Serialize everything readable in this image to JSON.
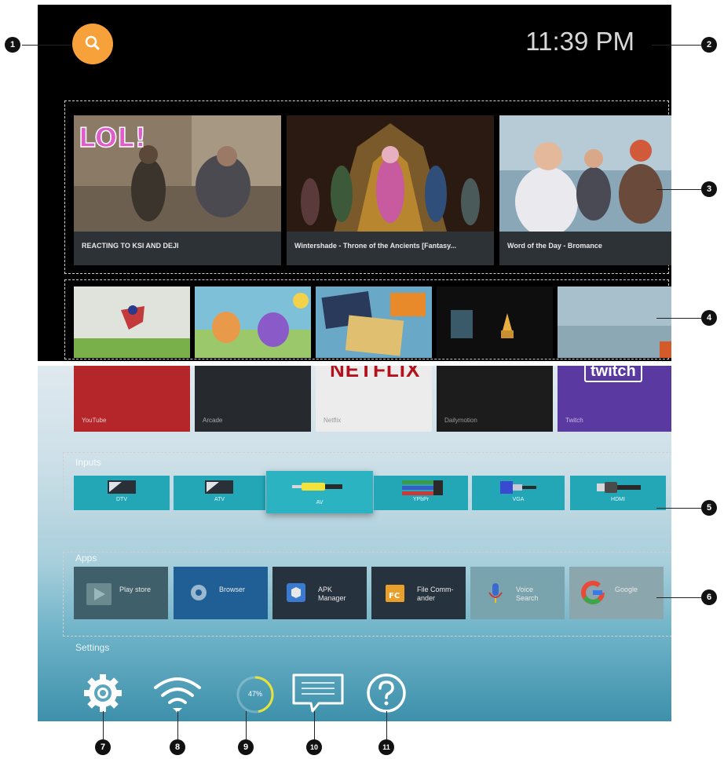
{
  "header": {
    "time": "11:39 PM"
  },
  "recommended": [
    {
      "title": "REACTING TO KSI AND DEJI",
      "overlay": "LOL!"
    },
    {
      "title": "Wintershade - Throne of the Ancients [Fantasy..."
    },
    {
      "title": "Word of the Day - Bromance"
    }
  ],
  "shelf_apps": [
    {
      "label": "YouTube",
      "banner": ""
    },
    {
      "label": "Arcade"
    },
    {
      "label": "Netflix",
      "banner": "NETFLIX"
    },
    {
      "label": "Dailymotion"
    },
    {
      "label": "Twitch",
      "banner": "twitch"
    }
  ],
  "inputs_section": {
    "label": "Inputs"
  },
  "inputs": [
    {
      "label": "DTV",
      "icon": "tv-icon"
    },
    {
      "label": "ATV",
      "icon": "tv-icon"
    },
    {
      "label": "AV",
      "icon": "rca-cable-icon"
    },
    {
      "label": "YPbPr",
      "icon": "component-cable-icon"
    },
    {
      "label": "VGA",
      "icon": "vga-cable-icon"
    },
    {
      "label": "HDMI",
      "icon": "hdmi-cable-icon"
    }
  ],
  "apps_section": {
    "label": "Apps"
  },
  "apps": [
    {
      "label": "Play store",
      "color": "#3f5f6b"
    },
    {
      "label": "Browser",
      "color": "#1f5f96"
    },
    {
      "label": "APK\nManager",
      "color": "#27323f"
    },
    {
      "label": "File Comm-\nander",
      "color": "#27323f"
    },
    {
      "label": "Voice\nSearch",
      "color": "#7aa4ad"
    },
    {
      "label": "Google",
      "color": "#8ca6ad"
    }
  ],
  "settings_section": {
    "label": "Settings"
  },
  "settings": {
    "storage_percent": "47%",
    "storage_fraction": 0.47
  },
  "callouts": [
    "1",
    "2",
    "3",
    "4",
    "5",
    "6",
    "7",
    "8",
    "9",
    "10",
    "11"
  ],
  "colors": {
    "search_orange": "#f6a13a",
    "input_teal": "#23a7b6",
    "storage_ring": "#e8e33a"
  }
}
